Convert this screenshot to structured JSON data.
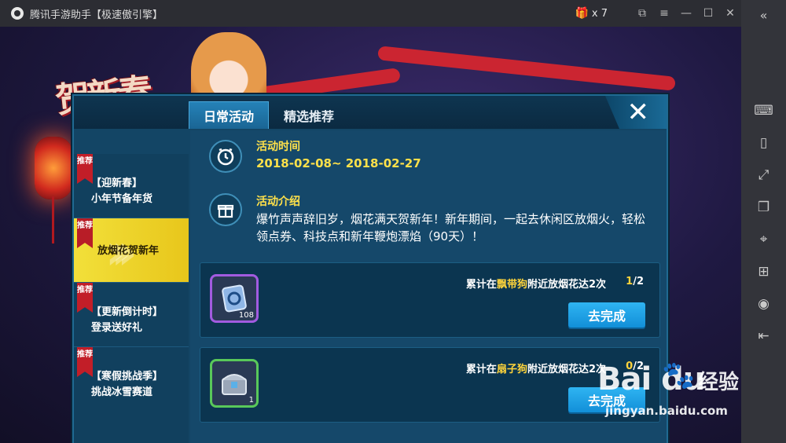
{
  "window": {
    "title": "腾讯手游助手【极速傲引擎】",
    "gift_count": "x 7",
    "buttons": [
      "restore-icon",
      "menu-icon",
      "minimize-icon",
      "maximize-icon",
      "close-icon"
    ]
  },
  "sidebar": {
    "items": [
      "collapse-icon",
      "keyboard-icon",
      "shake-icon",
      "fullscreen-icon",
      "multi-window-icon",
      "locate-icon",
      "screenshot-icon",
      "record-icon",
      "exit-icon"
    ]
  },
  "banner": {
    "title": "贺新春"
  },
  "dialog": {
    "tabs": [
      "日常活动",
      "精选推荐"
    ],
    "close_label": "✕",
    "left_items": [
      {
        "tag": "推荐",
        "line1": "【迎新春】",
        "line2": "小年节备年货"
      },
      {
        "tag": "推荐",
        "line1": "放烟花贺新年",
        "line2": ""
      },
      {
        "tag": "推荐",
        "line1": "【更新倒计时】",
        "line2": "登录送好礼"
      },
      {
        "tag": "推荐",
        "line1": "【寒假挑战季】",
        "line2": "挑战冰雪赛道"
      }
    ],
    "time_label": "活动时间",
    "time_value": "2018-02-08~ 2018-02-27",
    "intro_label": "活动介绍",
    "intro_text": "爆竹声声辞旧岁，烟花满天贺新年！新年期间，一起去休闲区放烟火，轻松领点券、科技点和新年鞭炮漂焰（90天）！",
    "tasks": [
      {
        "desc_prefix": "累计在",
        "desc_highlight": "飘带狗",
        "desc_suffix": "附近放烟花达2次",
        "progress_current": "1",
        "progress_total": "/2",
        "item_count": "108",
        "button": "去完成"
      },
      {
        "desc_prefix": "累计在",
        "desc_highlight": "扇子狗",
        "desc_suffix": "附近放烟花达2次",
        "progress_current": "0",
        "progress_total": "/2",
        "item_count": "1",
        "button": "去完成"
      }
    ]
  },
  "watermark": {
    "logo": "Bai du",
    "text": "经验",
    "url": "jingyan.baidu.com"
  }
}
